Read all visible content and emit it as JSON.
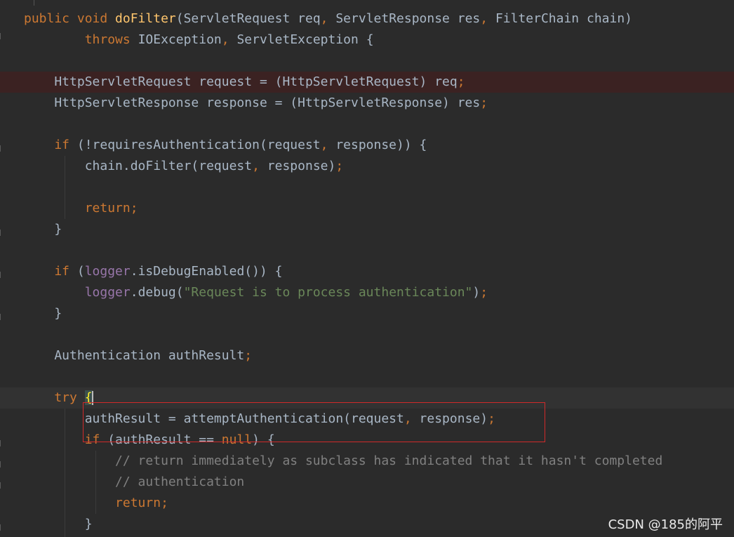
{
  "editor": {
    "lines": [
      {
        "id": "l1",
        "tokens": [
          {
            "t": "public ",
            "c": "kw"
          },
          {
            "t": "void ",
            "c": "kw"
          },
          {
            "t": "doFilter",
            "c": "fn"
          },
          {
            "t": "(ServletRequest req",
            "c": "type"
          },
          {
            "t": ", ",
            "c": "punc"
          },
          {
            "t": "ServletResponse res",
            "c": "type"
          },
          {
            "t": ", ",
            "c": "punc"
          },
          {
            "t": "FilterChain chain)",
            "c": "type"
          }
        ]
      },
      {
        "id": "l2",
        "tokens": [
          {
            "t": "        throws ",
            "c": "kw"
          },
          {
            "t": "IOException",
            "c": "type"
          },
          {
            "t": ", ",
            "c": "punc"
          },
          {
            "t": "ServletException {",
            "c": "type"
          }
        ]
      },
      {
        "id": "l3",
        "tokens": []
      },
      {
        "id": "l4",
        "style": "err",
        "tokens": [
          {
            "t": "    HttpServletRequest request = (HttpServletRequest) req",
            "c": "type"
          },
          {
            "t": ";",
            "c": "punc"
          }
        ]
      },
      {
        "id": "l5",
        "tokens": [
          {
            "t": "    HttpServletResponse response = (HttpServletResponse) res",
            "c": "type"
          },
          {
            "t": ";",
            "c": "punc"
          }
        ]
      },
      {
        "id": "l6",
        "tokens": []
      },
      {
        "id": "l7",
        "tokens": [
          {
            "t": "    if ",
            "c": "kw"
          },
          {
            "t": "(!requiresAuthentication(request",
            "c": "type"
          },
          {
            "t": ", ",
            "c": "punc"
          },
          {
            "t": "response)) {",
            "c": "type"
          }
        ]
      },
      {
        "id": "l8",
        "tokens": [
          {
            "t": "        chain.doFilter(request",
            "c": "type"
          },
          {
            "t": ", ",
            "c": "punc"
          },
          {
            "t": "response)",
            "c": "type"
          },
          {
            "t": ";",
            "c": "punc"
          }
        ]
      },
      {
        "id": "l9",
        "tokens": []
      },
      {
        "id": "l10",
        "tokens": [
          {
            "t": "        return;",
            "c": "kw"
          }
        ]
      },
      {
        "id": "l11",
        "tokens": [
          {
            "t": "    }",
            "c": "type"
          }
        ]
      },
      {
        "id": "l12",
        "tokens": []
      },
      {
        "id": "l13",
        "tokens": [
          {
            "t": "    if ",
            "c": "kw"
          },
          {
            "t": "(",
            "c": "type"
          },
          {
            "t": "logger",
            "c": "field"
          },
          {
            "t": ".isDebugEnabled()) {",
            "c": "type"
          }
        ]
      },
      {
        "id": "l14",
        "tokens": [
          {
            "t": "        ",
            "c": "type"
          },
          {
            "t": "logger",
            "c": "field"
          },
          {
            "t": ".debug(",
            "c": "type"
          },
          {
            "t": "\"Request is to process authentication\"",
            "c": "str"
          },
          {
            "t": ")",
            "c": "type"
          },
          {
            "t": ";",
            "c": "punc"
          }
        ]
      },
      {
        "id": "l15",
        "tokens": [
          {
            "t": "    }",
            "c": "type"
          }
        ]
      },
      {
        "id": "l16",
        "tokens": []
      },
      {
        "id": "l17",
        "tokens": [
          {
            "t": "    Authentication authResult",
            "c": "type"
          },
          {
            "t": ";",
            "c": "punc"
          }
        ]
      },
      {
        "id": "l18",
        "tokens": []
      },
      {
        "id": "l19",
        "style": "caretline",
        "tokens": [
          {
            "t": "    try ",
            "c": "kw"
          },
          {
            "t": "{",
            "c": "brace-match"
          },
          {
            "t": "",
            "c": "caret"
          }
        ]
      },
      {
        "id": "l20",
        "tokens": [
          {
            "t": "        authResult = attemptAuthentication(request",
            "c": "type"
          },
          {
            "t": ", ",
            "c": "punc"
          },
          {
            "t": "response)",
            "c": "type"
          },
          {
            "t": ";",
            "c": "punc"
          }
        ]
      },
      {
        "id": "l21",
        "tokens": [
          {
            "t": "        if ",
            "c": "kw"
          },
          {
            "t": "(authResult == ",
            "c": "type"
          },
          {
            "t": "null",
            "c": "kw"
          },
          {
            "t": ") {",
            "c": "type"
          }
        ]
      },
      {
        "id": "l22",
        "tokens": [
          {
            "t": "            // return immediately as subclass has indicated that it hasn't completed",
            "c": "com"
          }
        ]
      },
      {
        "id": "l23",
        "tokens": [
          {
            "t": "            // authentication",
            "c": "com"
          }
        ]
      },
      {
        "id": "l24",
        "tokens": [
          {
            "t": "            return;",
            "c": "kw"
          }
        ]
      },
      {
        "id": "l25",
        "tokens": [
          {
            "t": "        }",
            "c": "type"
          }
        ]
      }
    ]
  },
  "watermark": {
    "text": "CSDN @185的阿平"
  },
  "colors": {
    "background": "#2b2b2b",
    "keyword": "#cc7832",
    "function": "#ffc66d",
    "field": "#9876aa",
    "string": "#6a8759",
    "comment": "#808080",
    "text": "#a9b7c6",
    "annotation_box": "#d02a2a"
  }
}
